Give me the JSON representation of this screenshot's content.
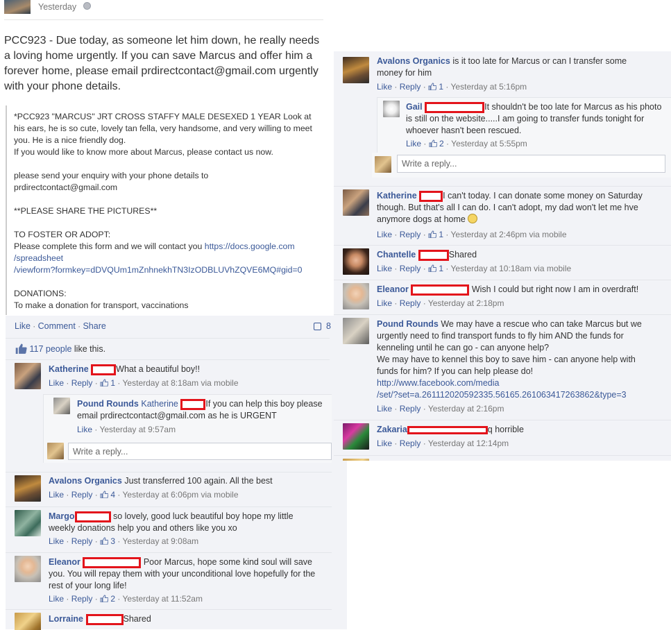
{
  "post": {
    "timestamp": "Yesterday",
    "message": "PCC923 - Due today, as someone let him down, he really needs a loving home urgently. If you can save Marcus and offer him a forever home, please email prdirectcontact@gmail.com urgently with your phone details.",
    "quote_lines": [
      "*PCC923 \"MARCUS\" JRT CROSS STAFFY MALE DESEXED 1 YEAR Look at his ears, he is so cute, lovely tan fella, very handsome, and very willing to meet you. He is a nice friendly dog.",
      "If you would like to know more about Marcus, please contact us now.",
      "",
      "please send your enquiry with your phone details to",
      "prdirectcontact@gmail.com",
      "",
      "**PLEASE SHARE THE PICTURES**",
      "",
      "TO FOSTER OR ADOPT:",
      "Please complete this form and we will contact you"
    ],
    "form_link": "https://docs.google.com/spreadsheet/viewform?formkey=dDVQUm1mZnhnekhTN3IzODBLUVhZQVE6MQ#gid=0",
    "form_link_lines": [
      "https://docs.google.com",
      "/spreadsheet",
      "/viewform?formkey=dDVQUm1mZnhnekhTN3IzODBLUVhZQVE6MQ#gid=0"
    ],
    "donation_lines": [
      "DONATIONS:",
      "To make a donation for transport, vaccinations"
    ],
    "actions": {
      "like": "Like",
      "comment": "Comment",
      "share": "Share",
      "share_count": "8"
    },
    "likes_count": "117 people",
    "likes_suffix": " like this."
  },
  "sep": " · ",
  "reply_placeholder": "Write a reply...",
  "left_comments": [
    {
      "name": "Katherine",
      "text": "What a beautiful boy!!",
      "like": "Like",
      "reply": "Reply",
      "likes": "1",
      "time": "Yesterday at 8:18am via mobile"
    },
    {
      "name": "Avalons Organics",
      "text": "Just transferred 100 again. All the best",
      "like": "Like",
      "reply": "Reply",
      "likes": "4",
      "time": "Yesterday at 6:06pm via mobile"
    },
    {
      "name": "Margo",
      "text": "so lovely, good luck beautiful boy hope my little weekly donations help you and others like you xo",
      "like": "Like",
      "reply": "Reply",
      "likes": "3",
      "time": "Yesterday at 9:08am"
    },
    {
      "name": "Eleanor",
      "text": "Poor Marcus, hope some kind soul will save you. You will repay them with your unconditional love hopefully for the rest of your long life!",
      "like": "Like",
      "reply": "Reply",
      "likes": "2",
      "time": "Yesterday at 11:52am"
    },
    {
      "name": "Lorraine",
      "text": "Shared"
    }
  ],
  "left_reply": {
    "name": "Pound Rounds",
    "mention": "Katherine",
    "text": "If you can help this boy please email prdirectcontact@gmail.com as he is URGENT",
    "like": "Like",
    "time": "Yesterday at 9:57am"
  },
  "right_comments": [
    {
      "name": "Avalons Organics",
      "text": "is it too late for Marcus or can I transfer some money for him",
      "like": "Like",
      "reply": "Reply",
      "likes": "1",
      "time": "Yesterday at 5:16pm"
    },
    {
      "name": "Katherine",
      "text": "I can't today. I can donate some money on Saturday though. But that's all I can do. I can't adopt, my dad won't let me hve anymore dogs at home",
      "like": "Like",
      "reply": "Reply",
      "likes": "1",
      "time": "Yesterday at 2:46pm via mobile"
    },
    {
      "name": "Chantelle",
      "text": "Shared",
      "like": "Like",
      "reply": "Reply",
      "likes": "1",
      "time": "Yesterday at 10:18am via mobile"
    },
    {
      "name": "Eleanor",
      "text": "Wish I could but right now I am in overdraft!",
      "like": "Like",
      "reply": "Reply",
      "time": "Yesterday at 2:18pm"
    },
    {
      "name": "Pound Rounds",
      "text": "We may have a rescue who can take Marcus but we urgently need to find transport funds to fly him AND the funds for kenneling until he can go - can anyone help?",
      "text2": "We may have to kennel this boy to save him - can anyone help with funds for him? If you can help please do!",
      "link_lines": [
        "http://www.facebook.com/media",
        "/set/?set=a.261112020592335.56165.261063417263862&type=3"
      ],
      "like": "Like",
      "reply": "Reply",
      "time": "Yesterday at 2:16pm"
    },
    {
      "name": "Zakaria",
      "text": "q horrible",
      "like": "Like",
      "reply": "Reply",
      "time": "Yesterday at 12:14pm"
    }
  ],
  "right_reply": {
    "name": "Gail",
    "text": "It shouldn't be too late for Marcus as his photo is still on the website.....I am going to transfer funds tonight for whoever hasn't been rescued.",
    "like": "Like",
    "likes": "2",
    "time": "Yesterday at 5:55pm"
  },
  "colors": {
    "link": "#3b5998",
    "panel": "#f2f3f7",
    "redaction": "#e3141b"
  }
}
